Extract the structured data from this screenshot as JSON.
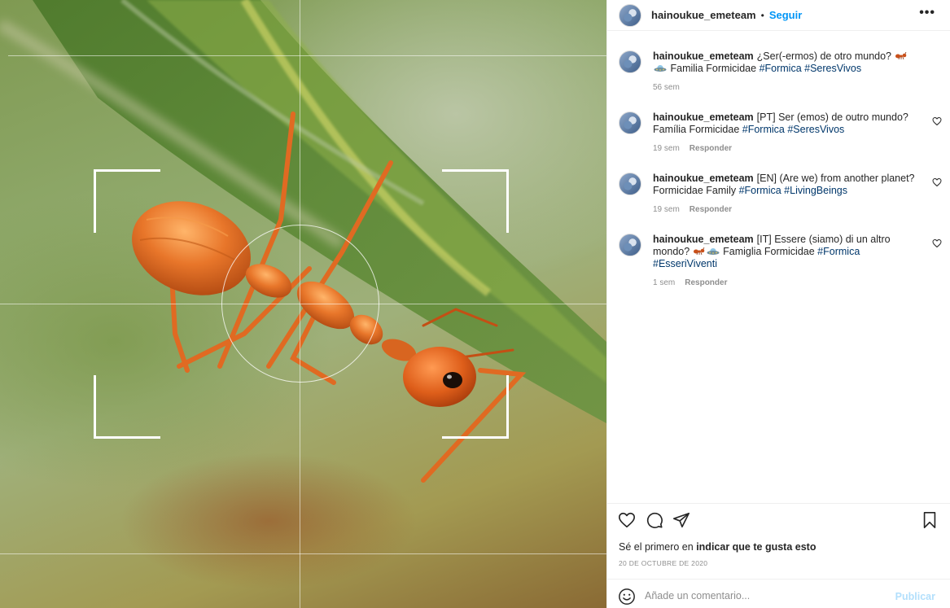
{
  "header": {
    "username": "hainoukue_emeteam",
    "separator": "•",
    "follow_label": "Seguir",
    "more_label": "•••"
  },
  "caption": {
    "username": "hainoukue_emeteam",
    "text_before": "¿Ser(-ermos) de otro mundo?",
    "text_after": "Familia Formicidae",
    "hashtags": [
      "#Formica",
      "#SeresVivos"
    ],
    "time": "56 sem"
  },
  "comments": [
    {
      "username": "hainoukue_emeteam",
      "text": "[PT] Ser (emos) de outro mundo? Família Formicidae",
      "hashtags": [
        "#Formica",
        "#SeresVivos"
      ],
      "time": "19 sem",
      "reply_label": "Responder"
    },
    {
      "username": "hainoukue_emeteam",
      "text": "[EN] (Are we) from another planet? Formicidae Family",
      "hashtags": [
        "#Formica",
        "#LivingBeings"
      ],
      "time": "19 sem",
      "reply_label": "Responder"
    },
    {
      "username": "hainoukue_emeteam",
      "text_before": "[IT] Essere (siamo) di un altro mondo?",
      "text_after": "Famiglia Formicidae",
      "hashtags": [
        "#Formica",
        "#EsseriViventi"
      ],
      "time": "1 sem",
      "reply_label": "Responder"
    }
  ],
  "likes": {
    "prefix": "Sé el primero en",
    "link": "indicar que te gusta esto"
  },
  "date": "20 DE OCTUBRE DE 2020",
  "comment_box": {
    "placeholder": "Añade un comentario...",
    "publish_label": "Publicar"
  },
  "icons": {
    "like": "heart-icon",
    "comment": "comment-icon",
    "share": "paper-plane-icon",
    "save": "bookmark-icon",
    "emoji": "smiley-icon",
    "more": "ellipsis-icon"
  },
  "colors": {
    "follow": "#0095f6",
    "hashtag": "#00376b",
    "muted": "#8e8e8e",
    "publish_disabled": "#b2dffc"
  }
}
